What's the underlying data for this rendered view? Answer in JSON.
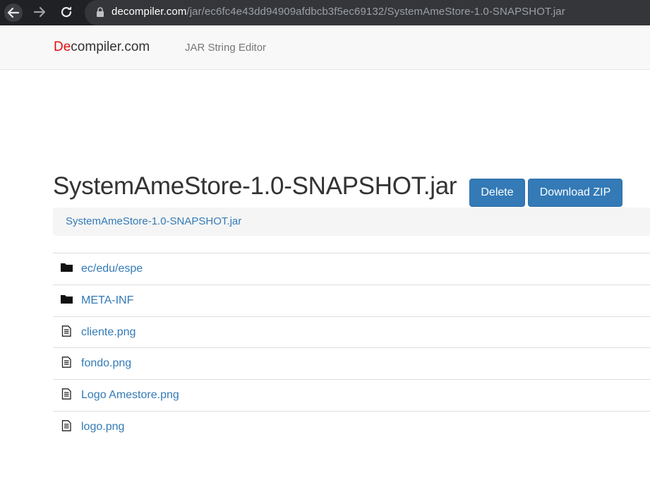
{
  "browser": {
    "url_host": "decompiler.com",
    "url_path": "/jar/ec6fc4e43dd94909afdbcb3f5ec69132/SystemAmeStore-1.0-SNAPSHOT.jar",
    "icons": {
      "back": "arrow-left-icon",
      "forward": "arrow-right-icon",
      "reload": "reload-icon",
      "lock": "lock-icon"
    }
  },
  "navbar": {
    "brand_accent": "De",
    "brand_rest": "compiler.com",
    "link": "JAR String Editor"
  },
  "page": {
    "title": "SystemAmeStore-1.0-SNAPSHOT.jar",
    "delete_label": "Delete",
    "download_label": "Download ZIP",
    "breadcrumb": "SystemAmeStore-1.0-SNAPSHOT.jar"
  },
  "files": [
    {
      "name": "ec/edu/espe",
      "icon": "folder-icon"
    },
    {
      "name": "META-INF",
      "icon": "folder-icon"
    },
    {
      "name": "cliente.png",
      "icon": "file-icon"
    },
    {
      "name": "fondo.png",
      "icon": "file-icon"
    },
    {
      "name": "Logo Amestore.png",
      "icon": "file-icon"
    },
    {
      "name": "logo.png",
      "icon": "file-icon"
    }
  ],
  "colors": {
    "brand_red": "#e01010",
    "link_blue": "#337ab7",
    "button_blue": "#337ab7",
    "chrome_dark": "#202124"
  }
}
